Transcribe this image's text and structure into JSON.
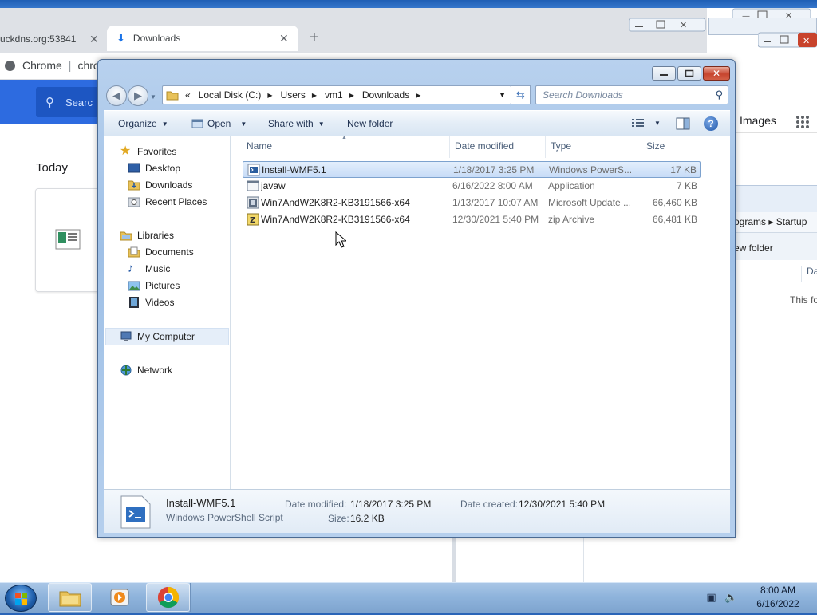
{
  "chrome": {
    "tab1_label": "uckdns.org:53841",
    "tab2_label": "Downloads",
    "omnibox_prefix": "Chrome",
    "omnibox_text": "chro",
    "search_placeholder": "Searc",
    "today_label": "Today",
    "images_label": "Images",
    "right_crumb": "ograms ▸ Startup",
    "right_new_folder": "ew folder",
    "right_col": "Da",
    "right_this": "This fo"
  },
  "explorer": {
    "address": [
      "Local Disk (C:)",
      "Users",
      "vm1",
      "Downloads"
    ],
    "address_prefix": "«",
    "search_placeholder": "Search Downloads",
    "toolbar": {
      "organize": "Organize",
      "open": "Open",
      "share_with": "Share with",
      "new_folder": "New folder"
    },
    "nav": {
      "favorites": "Favorites",
      "desktop": "Desktop",
      "downloads": "Downloads",
      "recent_places": "Recent Places",
      "libraries": "Libraries",
      "documents": "Documents",
      "music": "Music",
      "pictures": "Pictures",
      "videos": "Videos",
      "my_computer": "My Computer",
      "network": "Network"
    },
    "columns": {
      "name": "Name",
      "date_modified": "Date modified",
      "type": "Type",
      "size": "Size"
    },
    "files": [
      {
        "name": "Install-WMF5.1",
        "date": "1/18/2017 3:25 PM",
        "type": "Windows PowerS...",
        "size": "17 KB",
        "icon": "powershell-script-icon"
      },
      {
        "name": "javaw",
        "date": "6/16/2022 8:00 AM",
        "type": "Application",
        "size": "7 KB",
        "icon": "application-icon"
      },
      {
        "name": "Win7AndW2K8R2-KB3191566-x64",
        "date": "1/13/2017 10:07 AM",
        "type": "Microsoft Update ...",
        "size": "66,460 KB",
        "icon": "msu-package-icon"
      },
      {
        "name": "Win7AndW2K8R2-KB3191566-x64",
        "date": "12/30/2021 5:40 PM",
        "type": "zip Archive",
        "size": "66,481 KB",
        "icon": "zip-archive-icon"
      }
    ],
    "details": {
      "name": "Install-WMF5.1",
      "type": "Windows PowerShell Script",
      "date_modified_label": "Date modified:",
      "date_modified": "1/18/2017 3:25 PM",
      "size_label": "Size:",
      "size": "16.2 KB",
      "date_created_label": "Date created:",
      "date_created": "12/30/2021 5:40 PM"
    }
  },
  "taskbar": {
    "time": "8:00 AM",
    "date": "6/16/2022"
  },
  "colors": {
    "selection": "#cde1f8",
    "window_frame": "#a9c6e9",
    "chrome_blue": "#2d6be0"
  }
}
